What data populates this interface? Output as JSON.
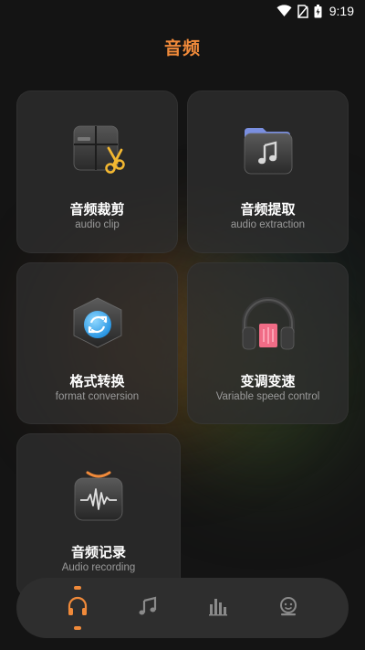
{
  "status_bar": {
    "time": "9:19",
    "icons": [
      "wifi-icon",
      "no-sim-icon",
      "battery-icon"
    ]
  },
  "header": {
    "title": "音频"
  },
  "cards": [
    {
      "title": "音频裁剪",
      "subtitle": "audio clip",
      "icon": "audio-clip-icon"
    },
    {
      "title": "音频提取",
      "subtitle": "audio extraction",
      "icon": "music-folder-icon"
    },
    {
      "title": "格式转换",
      "subtitle": "format conversion",
      "icon": "format-conversion-icon"
    },
    {
      "title": "变调变速",
      "subtitle": "Variable speed control",
      "icon": "headphones-icon"
    },
    {
      "title": "音频记录",
      "subtitle": "Audio recording",
      "icon": "waveform-icon"
    }
  ],
  "bottom_nav": {
    "items": [
      {
        "icon": "headphones-icon",
        "active": true
      },
      {
        "icon": "music-note-icon",
        "active": false
      },
      {
        "icon": "equalizer-icon",
        "active": false
      },
      {
        "icon": "profile-icon",
        "active": false
      }
    ]
  },
  "colors": {
    "accent": "#f08a3a",
    "background": "#141414",
    "card": "#2e2e2e",
    "subtitle": "#9a9a9a"
  }
}
